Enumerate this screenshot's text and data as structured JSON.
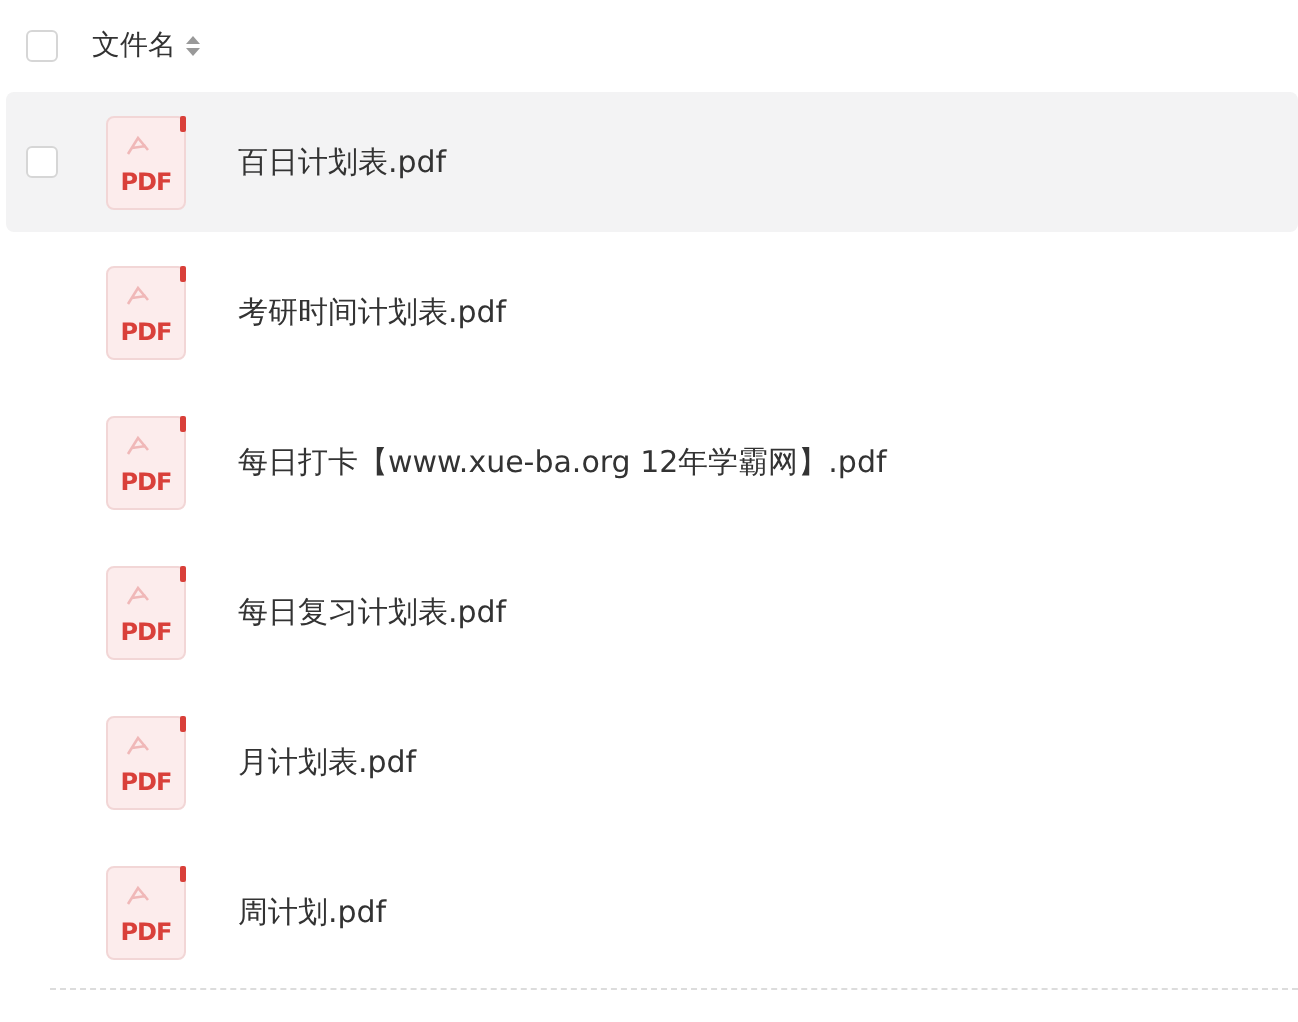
{
  "header": {
    "checked": false,
    "column_label": "文件名"
  },
  "files": [
    {
      "name": "百日计划表.pdf",
      "badge": "PDF",
      "hovered": true,
      "checked": false
    },
    {
      "name": "考研时间计划表.pdf",
      "badge": "PDF",
      "hovered": false,
      "checked": false
    },
    {
      "name": "每日打卡【www.xue-ba.org 12年学霸网】.pdf",
      "badge": "PDF",
      "hovered": false,
      "checked": false
    },
    {
      "name": "每日复习计划表.pdf",
      "badge": "PDF",
      "hovered": false,
      "checked": false
    },
    {
      "name": "月计划表.pdf",
      "badge": "PDF",
      "hovered": false,
      "checked": false
    },
    {
      "name": "周计划.pdf",
      "badge": "PDF",
      "hovered": false,
      "checked": false
    }
  ]
}
